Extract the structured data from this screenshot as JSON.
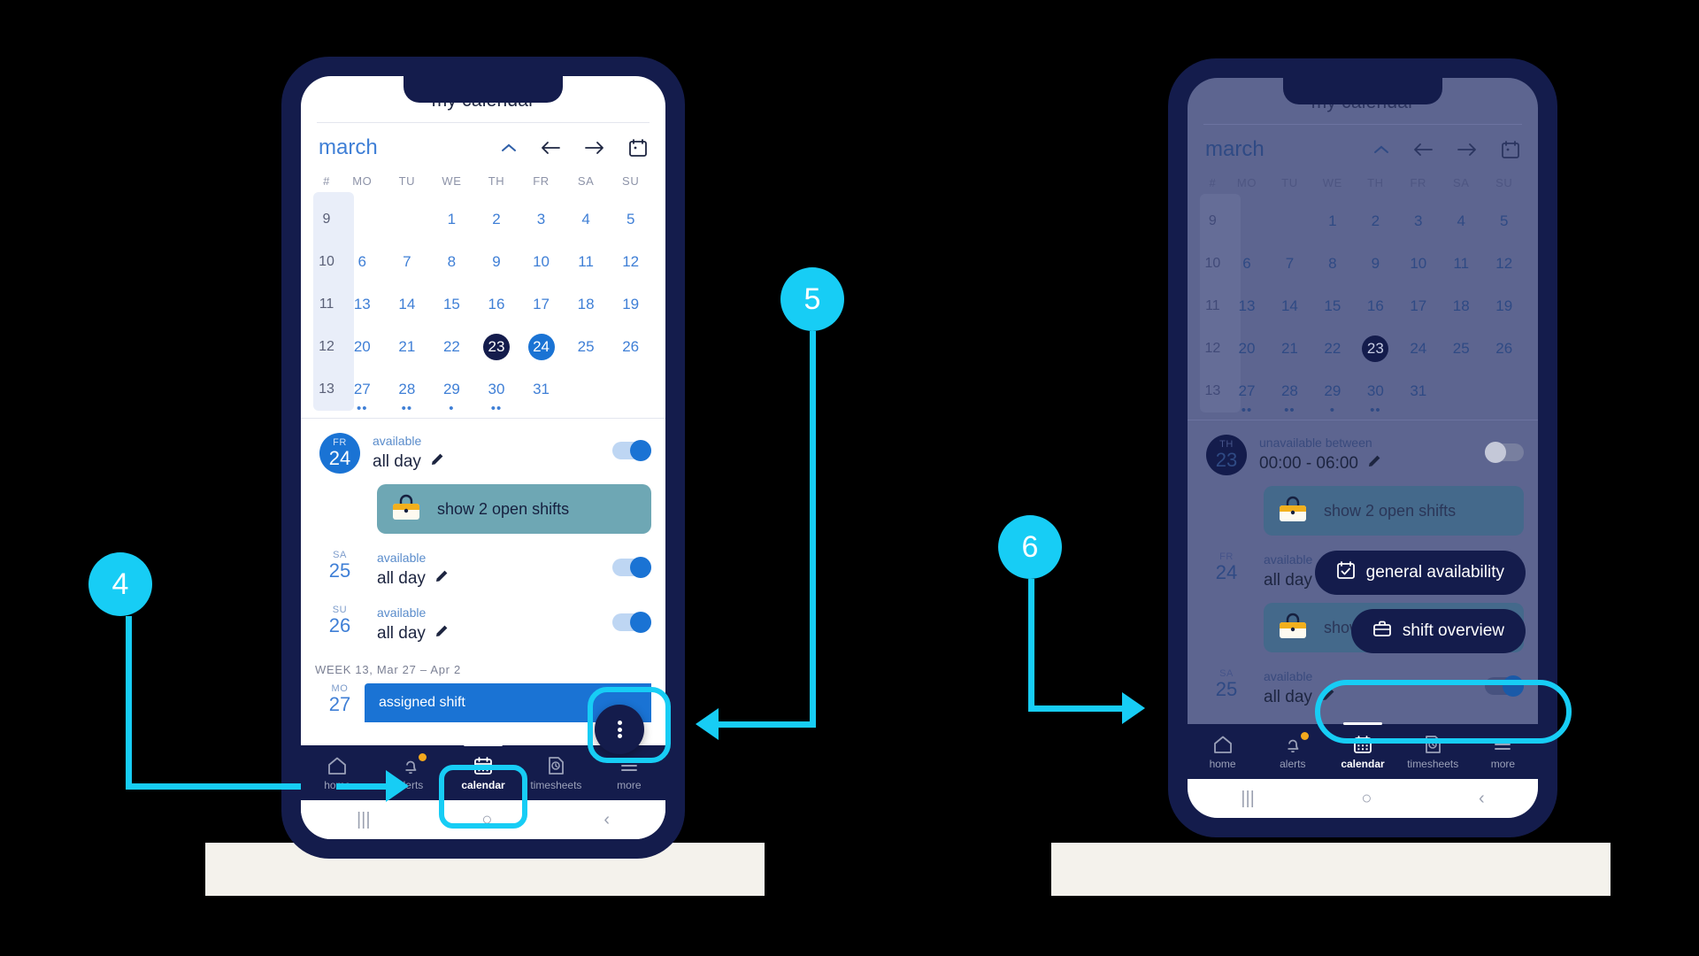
{
  "app": {
    "title": "my calendar",
    "month": "march",
    "weekday_headers": [
      "#",
      "MO",
      "TU",
      "WE",
      "TH",
      "FR",
      "SA",
      "SU"
    ],
    "weeks": [
      {
        "num": "9",
        "days": [
          "",
          "",
          "1",
          "2",
          "3",
          "4",
          "5"
        ]
      },
      {
        "num": "10",
        "days": [
          "6",
          "7",
          "8",
          "9",
          "10",
          "11",
          "12"
        ]
      },
      {
        "num": "11",
        "days": [
          "13",
          "14",
          "15",
          "16",
          "17",
          "18",
          "19"
        ]
      },
      {
        "num": "12",
        "days": [
          "20",
          "21",
          "22",
          "23",
          "24",
          "25",
          "26"
        ]
      },
      {
        "num": "13",
        "days": [
          "27",
          "28",
          "29",
          "30",
          "31",
          "",
          ""
        ]
      }
    ],
    "today": "23",
    "selected_phone1": "24",
    "selected_phone2": "23",
    "event_dots": {
      "27": 2,
      "28": 2,
      "29": 1,
      "30": 2
    }
  },
  "phone1": {
    "rows": [
      {
        "weekday": "FR",
        "day": "24",
        "status": "available",
        "time": "all day",
        "toggle": "on",
        "highlight": true
      },
      {
        "weekday": "SA",
        "day": "25",
        "status": "available",
        "time": "all day",
        "toggle": "on",
        "highlight": false
      },
      {
        "weekday": "SU",
        "day": "26",
        "status": "available",
        "time": "all day",
        "toggle": "on",
        "highlight": false
      }
    ],
    "shift_bar_label": "show 2 open shifts",
    "week_label": "WEEK 13, Mar 27 – Apr 2",
    "assigned_weekday": "MO",
    "assigned_day": "27",
    "assigned_label": "assigned shift",
    "fab_name": "more-options"
  },
  "phone2": {
    "rows": [
      {
        "weekday": "TH",
        "day": "23",
        "status": "unavailable between",
        "time": "00:00 - 06:00",
        "toggle": "off",
        "highlight": true
      },
      {
        "weekday": "FR",
        "day": "24",
        "status": "available",
        "time": "all day",
        "toggle": "on",
        "highlight": false
      },
      {
        "weekday": "SA",
        "day": "25",
        "status": "available",
        "time": "all day",
        "toggle": "on",
        "highlight": false
      }
    ],
    "shift_bar_label": "show 2 open shifts",
    "speed_dial": [
      {
        "label": "general availability",
        "icon": "calendar-check-icon"
      },
      {
        "label": "shift overview",
        "icon": "briefcase-icon"
      }
    ]
  },
  "bottom_nav": {
    "items": [
      {
        "label": "home",
        "icon": "home-icon",
        "active": false,
        "badge": false
      },
      {
        "label": "alerts",
        "icon": "bell-icon",
        "active": false,
        "badge": true
      },
      {
        "label": "calendar",
        "icon": "calendar-icon",
        "active": true,
        "badge": false
      },
      {
        "label": "timesheets",
        "icon": "timesheet-icon",
        "active": false,
        "badge": false
      },
      {
        "label": "more",
        "icon": "hamburger-icon",
        "active": false,
        "badge": false
      }
    ]
  },
  "system_nav": {
    "recents": "|||",
    "home": "○",
    "back": "‹"
  },
  "callouts": [
    {
      "number": "4",
      "target": "calendar-tab-phone1"
    },
    {
      "number": "5",
      "target": "fab-phone1"
    },
    {
      "number": "6",
      "target": "shift-overview-phone2"
    }
  ],
  "colors": {
    "accent_cyan": "#17cdf5",
    "brand_navy": "#141c4c",
    "brand_blue": "#1a73d4",
    "shift_teal": "#6ea7b4",
    "badge_orange": "#f2a81d",
    "plinth_cream": "#f4f2ec"
  }
}
